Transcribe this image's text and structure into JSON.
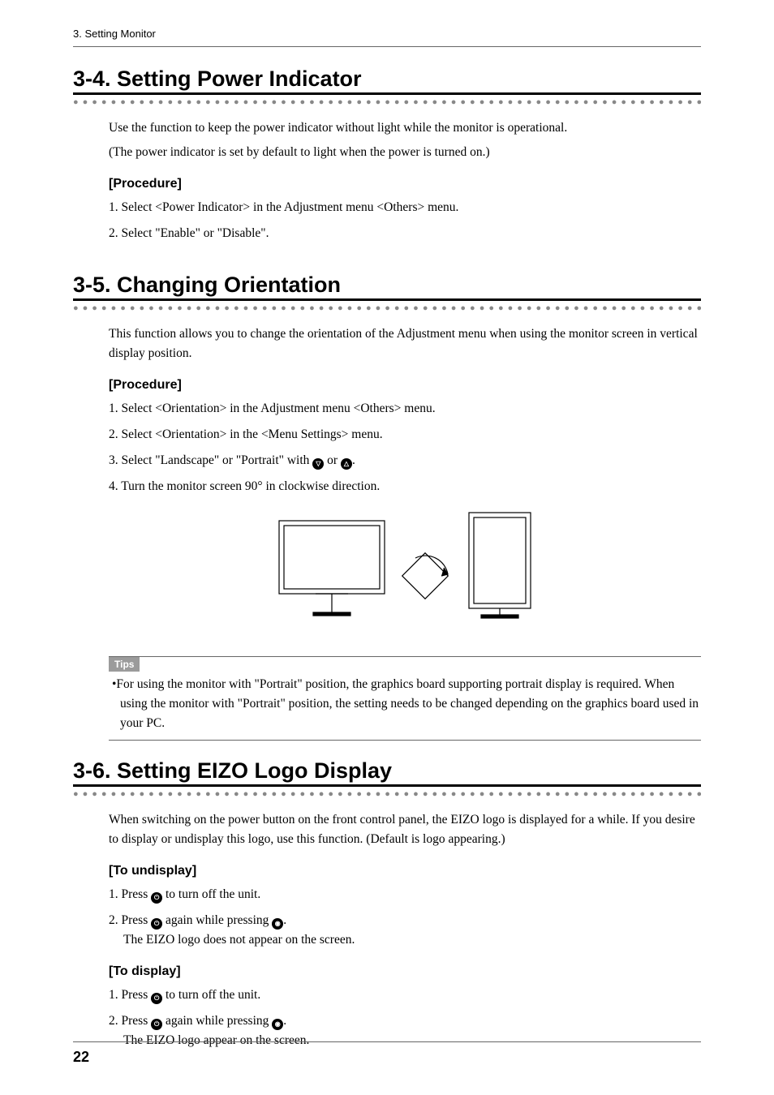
{
  "running_head": "3. Setting Monitor",
  "dots": "●●●●●●●●●●●●●●●●●●●●●●●●●●●●●●●●●●●●●●●●●●●●●●●●●●●●●●●●●●●●●●●●●●●●●●●●●●●●●●●●●●●●●●●●●●●●●●●●",
  "s34": {
    "heading": "3-4. Setting Power Indicator",
    "para1": "Use the function to keep the power indicator without light while the monitor is operational.",
    "para2": "(The power indicator is set by default to light when the power is turned on.)",
    "procedure_h": "[Procedure]",
    "step1": "1. Select <Power Indicator> in the Adjustment menu <Others> menu.",
    "step2": "2. Select \"Enable\" or \"Disable\"."
  },
  "s35": {
    "heading": "3-5. Changing Orientation",
    "para1": "This function allows you to change the orientation of the Adjustment menu when using the monitor screen in vertical display position.",
    "procedure_h": "[Procedure]",
    "step1": "1. Select <Orientation> in the Adjustment menu <Others> menu.",
    "step2": "2. Select <Orientation> in the <Menu Settings> menu.",
    "step3a": "3. Select \"Landscape\" or \"Portrait\" with ",
    "step3or": " or ",
    "step3b": ".",
    "step4": "4. Turn the monitor screen 90° in clockwise direction.",
    "tips_label": "Tips",
    "tip1": "•For using the monitor with \"Portrait\" position, the graphics board supporting portrait display is required. When using the monitor with \"Portrait\" position, the setting needs to be changed depending on the graphics board used in your PC."
  },
  "s36": {
    "heading": "3-6. Setting EIZO Logo Display",
    "para1": "When switching on the power button on the front control panel, the EIZO logo is displayed for a while. If you desire to display or undisplay this logo, use this function. (Default is logo appearing.)",
    "undisplay_h": "[To undisplay]",
    "u_step1a": "1. Press ",
    "u_step1b": " to turn off the unit.",
    "u_step2a": "2. Press ",
    "u_step2m": " again while pressing ",
    "u_step2b": ".",
    "u_step2sub": "The EIZO logo does not appear on the screen.",
    "display_h": "[To display]",
    "d_step1a": "1. Press ",
    "d_step1b": " to turn off the unit.",
    "d_step2a": "2. Press ",
    "d_step2m": " again while pressing ",
    "d_step2b": ".",
    "d_step2sub": "The EIZO logo appear on the screen."
  },
  "icons": {
    "down": "▽",
    "up": "△",
    "power": "⏻",
    "enter": "◉"
  },
  "page_number": "22"
}
